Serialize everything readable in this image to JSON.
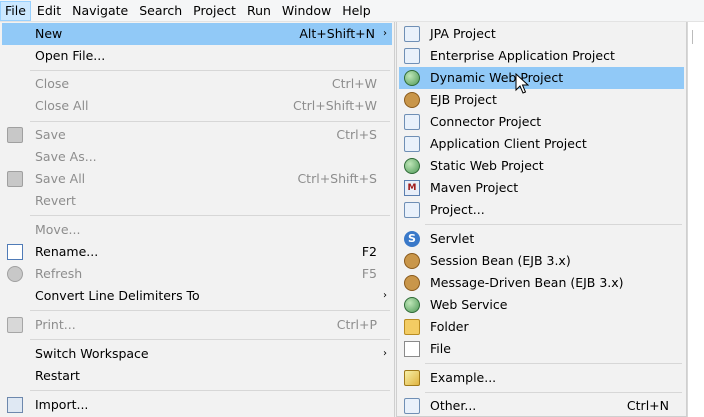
{
  "menubar": {
    "items": [
      "File",
      "Edit",
      "Navigate",
      "Search",
      "Project",
      "Run",
      "Window",
      "Help"
    ]
  },
  "file_menu": {
    "new": {
      "label": "New",
      "shortcut": "Alt+Shift+N",
      "arrow": "›"
    },
    "open_file": {
      "label": "Open File..."
    },
    "close": {
      "label": "Close",
      "shortcut": "Ctrl+W"
    },
    "close_all": {
      "label": "Close All",
      "shortcut": "Ctrl+Shift+W"
    },
    "save": {
      "label": "Save",
      "shortcut": "Ctrl+S"
    },
    "save_as": {
      "label": "Save As..."
    },
    "save_all": {
      "label": "Save All",
      "shortcut": "Ctrl+Shift+S"
    },
    "revert": {
      "label": "Revert"
    },
    "move": {
      "label": "Move..."
    },
    "rename": {
      "label": "Rename...",
      "shortcut": "F2"
    },
    "refresh": {
      "label": "Refresh",
      "shortcut": "F5"
    },
    "convert": {
      "label": "Convert Line Delimiters To",
      "arrow": "›"
    },
    "print": {
      "label": "Print...",
      "shortcut": "Ctrl+P"
    },
    "switch_workspace": {
      "label": "Switch Workspace",
      "arrow": "›"
    },
    "restart": {
      "label": "Restart"
    },
    "import": {
      "label": "Import..."
    }
  },
  "new_submenu": {
    "items": [
      {
        "label": "JPA Project"
      },
      {
        "label": "Enterprise Application Project"
      },
      {
        "label": "Dynamic Web Project"
      },
      {
        "label": "EJB Project"
      },
      {
        "label": "Connector Project"
      },
      {
        "label": "Application Client Project"
      },
      {
        "label": "Static Web Project"
      },
      {
        "label": "Maven Project"
      },
      {
        "label": "Project..."
      },
      {
        "label": "Servlet"
      },
      {
        "label": "Session Bean (EJB 3.x)"
      },
      {
        "label": "Message-Driven Bean (EJB 3.x)"
      },
      {
        "label": "Web Service"
      },
      {
        "label": "Folder"
      },
      {
        "label": "File"
      },
      {
        "label": "Example..."
      },
      {
        "label": "Other...",
        "shortcut": "Ctrl+N"
      }
    ]
  },
  "colors": {
    "highlight": "#91c9f7",
    "menu_bg": "#f2f2f2",
    "disabled_text": "#8d8d8d"
  }
}
